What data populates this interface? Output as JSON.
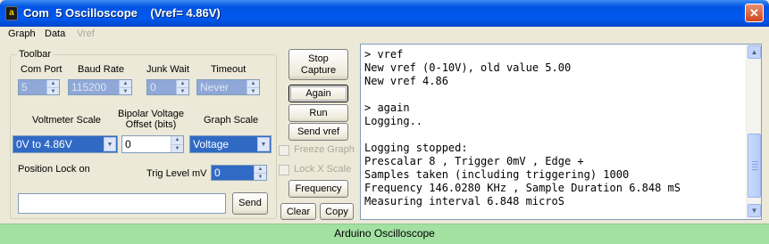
{
  "window": {
    "title": "Com  5 Oscilloscope    (Vref= 4.86V)",
    "icon": "oscilloscope-app-icon",
    "icon_glyph": "a",
    "close_glyph": "✕"
  },
  "menu": {
    "graph": "Graph",
    "data": "Data",
    "vref": "Vref"
  },
  "toolbar": {
    "legend": "Toolbar",
    "com_port": {
      "label": "Com Port",
      "value": "5"
    },
    "baud_rate": {
      "label": "Baud Rate",
      "value": "115200"
    },
    "junk_wait": {
      "label": "Junk Wait",
      "value": "0"
    },
    "timeout": {
      "label": "Timeout",
      "value": "Never"
    },
    "voltmeter_scale": {
      "label": "Voltmeter Scale",
      "value": "0V to  4.86V"
    },
    "bipolar_offset": {
      "label_line1": "Bipolar Voltage",
      "label_line2": "Offset (bits)",
      "value": "0"
    },
    "graph_scale": {
      "label": "Graph Scale",
      "value": "Voltage"
    },
    "position_lock": "Position Lock on",
    "trig_level": {
      "label": "Trig Level mV",
      "value": "0"
    },
    "send_input_value": "",
    "send_button": "Send"
  },
  "buttons": {
    "stop_capture_line1": "Stop",
    "stop_capture_line2": "Capture",
    "again": "Again",
    "run": "Run",
    "send_vref": "Send vref",
    "freeze_graph": "Freeze Graph",
    "lock_x_scale": "Lock X Scale",
    "frequency": "Frequency",
    "clear": "Clear",
    "copy": "Copy"
  },
  "console": {
    "text": "> vref\nNew vref (0-10V), old value 5.00\nNew vref 4.86\n\n> again\nLogging..\n\nLogging stopped:\nPrescalar 8 , Trigger 0mV , Edge +\nSamples taken (including triggering) 1000\nFrequency 146.0280 KHz , Sample Duration 6.848 mS\nMeasuring interval 6.848 microS",
    "scroll_up": "▲",
    "scroll_down": "▼"
  },
  "spin_glyphs": {
    "up": "▲",
    "down": "▼"
  },
  "status": {
    "text": "Arduino Oscilloscope"
  },
  "colors": {
    "titlebar": "#0054e3",
    "selection": "#316ac5",
    "status_bar": "#a3e1a3",
    "window_bg": "#ece9d8"
  }
}
